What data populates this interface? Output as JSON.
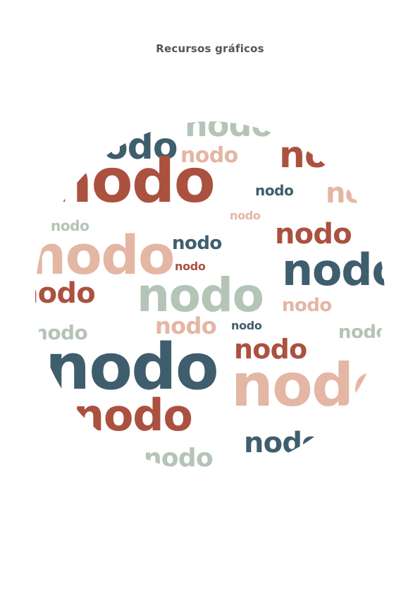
{
  "page": {
    "title": "Recursos gráficos"
  },
  "colors": {
    "title": "#555555",
    "rust": "#AB513F",
    "teal": "#3F5E6D",
    "peach": "#E4B6A4",
    "sage": "#B4C4B6"
  },
  "words": [
    {
      "text": "nodo",
      "color": "sage"
    },
    {
      "text": "nodo",
      "color": "teal"
    },
    {
      "text": "nodo",
      "color": "peach"
    },
    {
      "text": "nodo",
      "color": "rust"
    },
    {
      "text": "nodo",
      "color": "rust"
    },
    {
      "text": "nodo",
      "color": "teal"
    },
    {
      "text": "nodo",
      "color": "peach"
    },
    {
      "text": "nodo",
      "color": "peach"
    },
    {
      "text": "nodo",
      "color": "sage"
    },
    {
      "text": "nodo",
      "color": "rust"
    },
    {
      "text": "nodo",
      "color": "peach"
    },
    {
      "text": "nodo",
      "color": "teal"
    },
    {
      "text": "nodo",
      "color": "rust"
    },
    {
      "text": "nodo",
      "color": "teal"
    },
    {
      "text": "nodo",
      "color": "rust"
    },
    {
      "text": "nodo",
      "color": "sage"
    },
    {
      "text": "nodo",
      "color": "peach"
    },
    {
      "text": "nodo",
      "color": "peach"
    },
    {
      "text": "nodo",
      "color": "sage"
    },
    {
      "text": "nodo",
      "color": "teal"
    },
    {
      "text": "nodo",
      "color": "sage"
    },
    {
      "text": "nodo",
      "color": "rust"
    },
    {
      "text": "nodo",
      "color": "teal"
    },
    {
      "text": "nodo",
      "color": "peach"
    },
    {
      "text": "nodo",
      "color": "rust"
    },
    {
      "text": "nodo",
      "color": "sage"
    },
    {
      "text": "nodo",
      "color": "teal"
    }
  ]
}
